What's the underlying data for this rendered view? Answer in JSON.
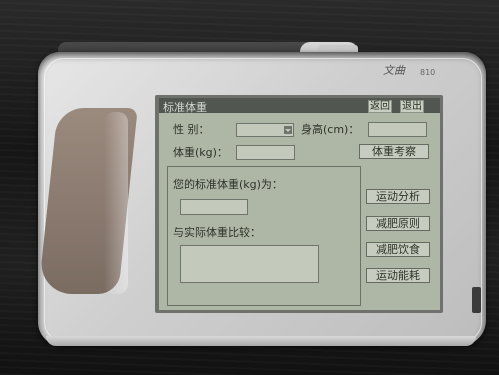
{
  "device": {
    "brand_logo": "文曲",
    "model": "810"
  },
  "app": {
    "title": "标准体重",
    "header_buttons": [
      "返回",
      "退出"
    ],
    "form": {
      "gender_label": "性  别：",
      "gender_value": "",
      "height_label": "身高(cm)：",
      "height_value": "",
      "weight_label": "体重(kg)：",
      "weight_value": "",
      "weight_check_button": "体重考察"
    },
    "result": {
      "standard_weight_label": "您的标准体重(kg)为：",
      "standard_weight_value": "",
      "compare_label": "与实际体重比较：",
      "compare_value": ""
    },
    "side_buttons": [
      "运动分析",
      "减肥原则",
      "减肥饮食",
      "运动能耗"
    ]
  }
}
